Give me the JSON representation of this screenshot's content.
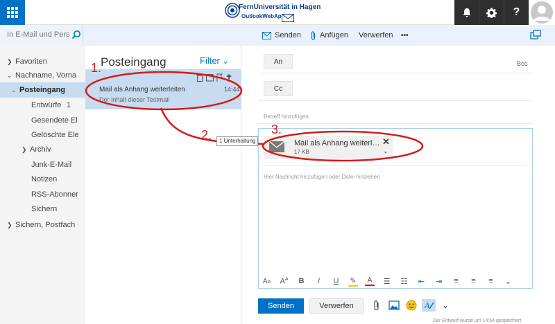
{
  "header": {
    "brand_title": "FernUniversität in Hagen",
    "brand_sub": "OutlookWebApp",
    "icons": [
      "bell-icon",
      "gear-icon",
      "help-icon",
      "avatar"
    ],
    "help_glyph": "?"
  },
  "search": {
    "placeholder": "In E-Mail und Pers…"
  },
  "toolbar": {
    "send_label": "Senden",
    "attach_label": "Anfügen",
    "discard_label": "Verwerfen",
    "more_label": "•••"
  },
  "nav": {
    "favorites": "Favoriten",
    "account": "Nachname, Vorna",
    "items": [
      {
        "label": "Posteingang",
        "count": ""
      },
      {
        "label": "Entwürfe",
        "count": "1"
      },
      {
        "label": "Gesendete El",
        "count": ""
      },
      {
        "label": "Gelöschte Ele",
        "count": ""
      },
      {
        "label": "Archiv",
        "count": ""
      },
      {
        "label": "Junk-E-Mail",
        "count": ""
      },
      {
        "label": "Notizen",
        "count": ""
      },
      {
        "label": "RSS-Abonner",
        "count": ""
      },
      {
        "label": "Sichern",
        "count": ""
      }
    ],
    "secondary_account": "Sichern, Postfach"
  },
  "message_list": {
    "title": "Posteingang",
    "filter_label": "Filter",
    "messages": [
      {
        "subject": "Mail als Anhang weiterleiten",
        "time": "14:44",
        "preview": "Der Inhalt dieser Testmail"
      }
    ]
  },
  "compose": {
    "to_label": "An",
    "cc_label": "Cc",
    "bcc_label": "Bcc",
    "subject_placeholder": "Betreff hinzufügen",
    "attachment": {
      "name": "Mail als Anhang weiterl…",
      "size": "17 KB"
    },
    "body_placeholder": "Hier Nachricht hinzufügen oder Datei hinziehen",
    "send_label": "Senden",
    "discard_label": "Verwerfen",
    "draft_note": "Der Entwurf wurde um 14:54 gespeichert"
  },
  "annotations": {
    "step1": "1.",
    "step2": "2.",
    "step3": "3.",
    "drag_label": "1 Unterhaltung"
  },
  "colors": {
    "accent": "#0072c6",
    "selection": "#c7dcf0",
    "annotation": "#d61a1a",
    "dark_bar": "#2f2f2f"
  }
}
